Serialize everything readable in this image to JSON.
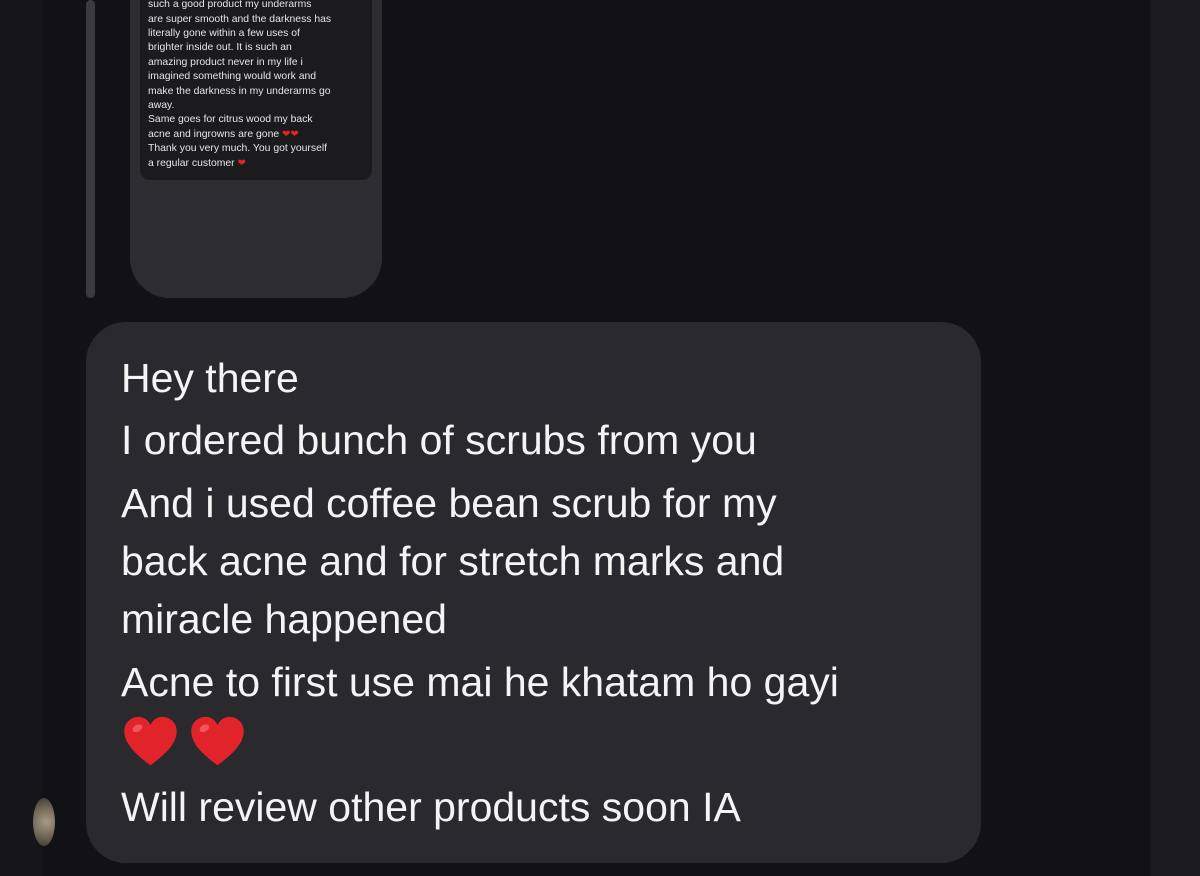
{
  "story_reply": {
    "partial_top_line": "such a good product  my underarms",
    "lines": [
      "are super smooth and the darkness has",
      "literally gone within a few uses of",
      "brighter inside out. It is such an",
      "amazing product never in my life i",
      "imagined something would work and",
      "make the darkness in my underarms go",
      "away.",
      "Same goes for citrus wood my back",
      "acne and ingrowns are gone",
      "Thank you very much. You got yourself",
      "a regular customer"
    ]
  },
  "message": {
    "lines": [
      "Hey there",
      "I ordered bunch of scrubs from you",
      "And i used coffee bean scrub for my",
      "back acne and for stretch marks and",
      "miracle happened",
      "Acne to first use mai he khatam ho gayi",
      "Will review other products soon IA"
    ],
    "emoji_hearts": 2
  },
  "colors": {
    "background": "#121216",
    "bubble": "#2a2a2e",
    "text": "#f4f4f4",
    "heart": "#e0242a"
  },
  "icons": [
    "heart-emoji",
    "avatar"
  ]
}
